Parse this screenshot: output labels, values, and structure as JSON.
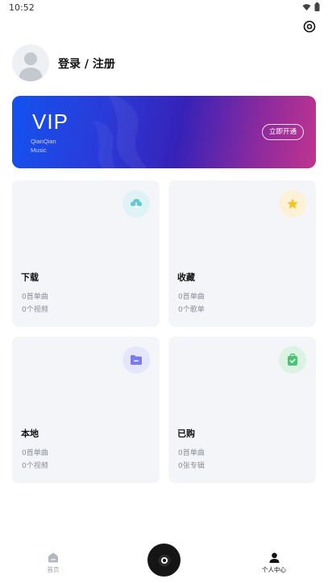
{
  "status_bar": {
    "time": "10:52",
    "icons": [
      "wifi-icon",
      "battery-icon"
    ]
  },
  "header": {
    "settings_icon": "settings-icon",
    "login_label": "登录 / 注册",
    "avatar_icon": "default-avatar"
  },
  "vip": {
    "title": "VIP",
    "subtitle_line1": "QianQian",
    "subtitle_line2": "Music",
    "button_label": "立即开通"
  },
  "cards": [
    {
      "title": "下载",
      "line1": "0首单曲",
      "line2": "0个视频",
      "icon": "cloud-download-icon",
      "icon_bg": "#dff3f6",
      "icon_color": "#66c6d6"
    },
    {
      "title": "收藏",
      "line1": "0首单曲",
      "line2": "0个歌单",
      "icon": "star-icon",
      "icon_bg": "#fdf1d8",
      "icon_color": "#f6c323"
    },
    {
      "title": "本地",
      "line1": "0首单曲",
      "line2": "0个视频",
      "icon": "folder-icon",
      "icon_bg": "#e6e6fb",
      "icon_color": "#7a7bef"
    },
    {
      "title": "已购",
      "line1": "0首单曲",
      "line2": "0张专辑",
      "icon": "purchased-bag-icon",
      "icon_bg": "#dcf3e3",
      "icon_color": "#4cc274"
    }
  ],
  "tab_bar": {
    "home_label": "首页",
    "profile_label": "个人中心",
    "player_icon": "vinyl-disc-icon"
  }
}
